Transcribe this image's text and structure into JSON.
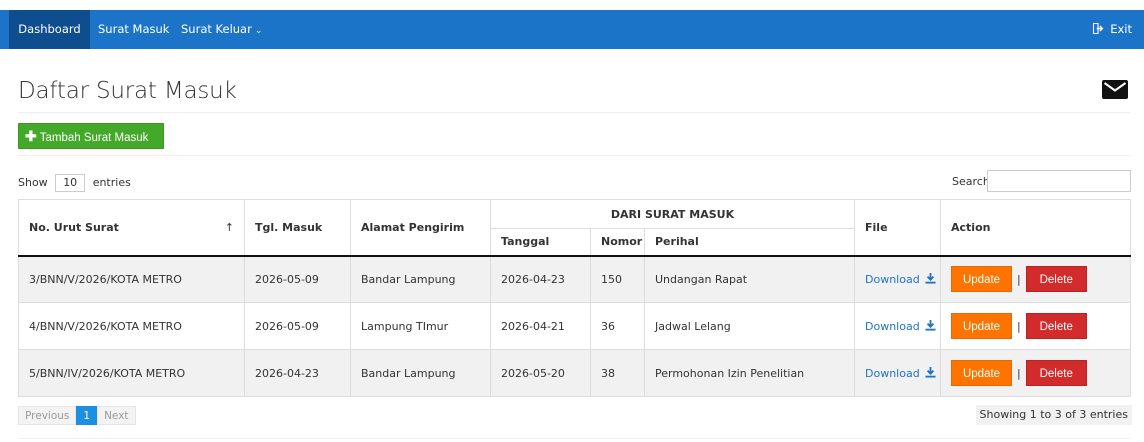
{
  "nav": {
    "dashboard": "Dashboard",
    "surat_masuk": "Surat Masuk",
    "surat_keluar": "Surat Keluar",
    "exit": "Exit"
  },
  "page": {
    "title": "Daftar Surat Masuk",
    "add_button": "Tambah Surat Masuk"
  },
  "controls": {
    "show_label": "Show",
    "entries_label": "entries",
    "page_length": "10",
    "search_label": "Search:",
    "search_value": ""
  },
  "table": {
    "headers": {
      "no_urut": "No. Urut Surat",
      "tgl_masuk": "Tgl. Masuk",
      "alamat": "Alamat Pengirim",
      "group": "DARI SURAT MASUK",
      "tanggal": "Tanggal",
      "nomor": "Nomor",
      "perihal": "Perihal",
      "file": "File",
      "action": "Action"
    },
    "sort_indicator": "↑",
    "download_label": "Download",
    "update_label": "Update",
    "delete_label": "Delete",
    "separator": "|",
    "rows": [
      {
        "no_urut": "3/BNN/V/2026/KOTA METRO",
        "tgl_masuk": "2026-05-09",
        "alamat": "Bandar Lampung",
        "tanggal": "2026-04-23",
        "nomor": "150",
        "perihal": "Undangan Rapat"
      },
      {
        "no_urut": "4/BNN/V/2026/KOTA METRO",
        "tgl_masuk": "2026-05-09",
        "alamat": "Lampung TImur",
        "tanggal": "2026-04-21",
        "nomor": "36",
        "perihal": "Jadwal Lelang"
      },
      {
        "no_urut": "5/BNN/IV/2026/KOTA METRO",
        "tgl_masuk": "2026-04-23",
        "alamat": "Bandar Lampung",
        "tanggal": "2026-05-20",
        "nomor": "38",
        "perihal": "Permohonan Izin Penelitian"
      }
    ]
  },
  "pagination": {
    "previous": "Previous",
    "current": "1",
    "next": "Next",
    "info": "Showing 1 to 3 of 3 entries"
  },
  "colors": {
    "navbar": "#1c74c8",
    "add_button": "#44a829",
    "update_button": "#ff7300",
    "delete_button": "#d22b2b",
    "link": "#1c74c8"
  },
  "icons": {
    "exit": "exit-icon",
    "mail": "envelope-icon",
    "add": "plus-icon",
    "download": "download-icon"
  }
}
